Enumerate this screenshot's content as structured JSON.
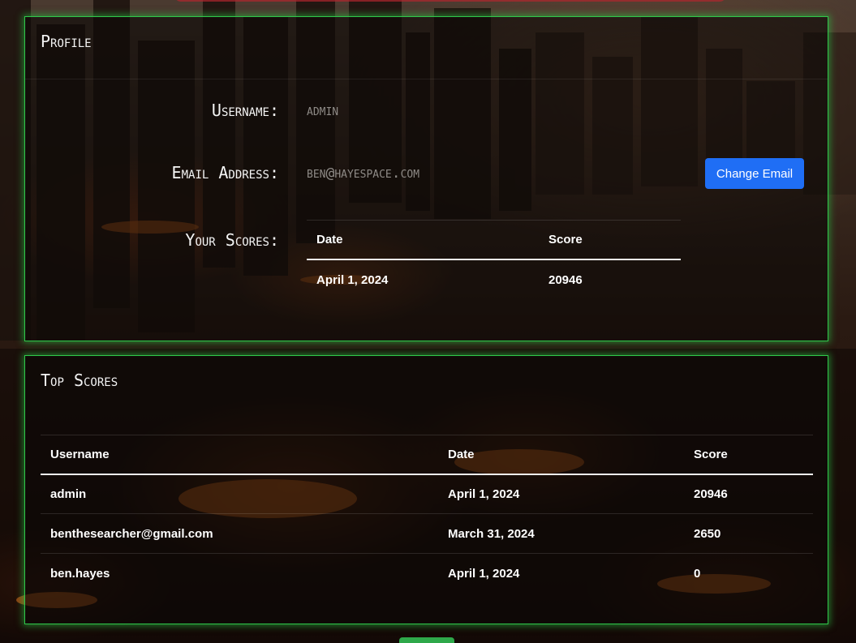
{
  "colors": {
    "panel_border": "#2fc84a",
    "primary_button": "#1f6ef5",
    "muted_value": "#8e8a86",
    "background_dark": "#1a0d07"
  },
  "profile": {
    "title": "Profile",
    "username_label": "Username:",
    "username_value": "admin",
    "email_label": "Email Address:",
    "email_value": "ben@hayespace.com",
    "change_email_label": "Change Email",
    "scores_label": "Your Scores:",
    "scores_table": {
      "headers": [
        "Date",
        "Score"
      ],
      "rows": [
        {
          "date": "April 1, 2024",
          "score": "20946"
        }
      ]
    }
  },
  "top_scores": {
    "title": "Top Scores",
    "headers": [
      "Username",
      "Date",
      "Score"
    ],
    "rows": [
      {
        "username": "admin",
        "date": "April 1, 2024",
        "score": "20946"
      },
      {
        "username": "benthesearcher@gmail.com",
        "date": "March 31, 2024",
        "score": "2650"
      },
      {
        "username": "ben.hayes",
        "date": "April 1, 2024",
        "score": "0"
      }
    ]
  }
}
